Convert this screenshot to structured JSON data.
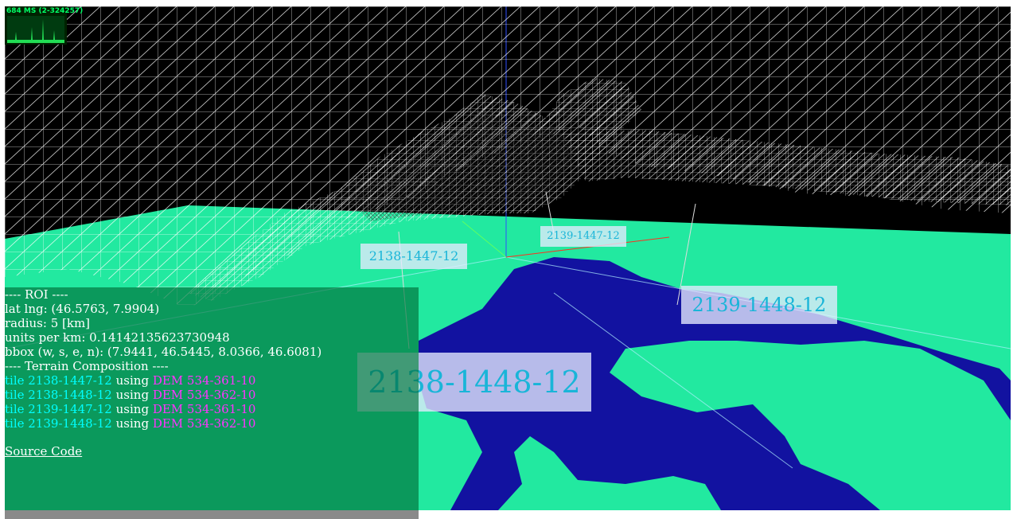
{
  "stats": {
    "text": "684 MS (2-324257)"
  },
  "tile_labels": {
    "t1": "2138-1447-12",
    "t2": "2139-1447-12",
    "t3": "2139-1448-12",
    "t4": "2138-1448-12"
  },
  "info": {
    "roi_header": "---- ROI ----",
    "lat_lng": "lat lng: (46.5763, 7.9904)",
    "radius": "radius: 5 [km]",
    "units_per_km": "units per km: 0.14142135623730948",
    "bbox": "bbox (w, s, e, n): (7.9441, 46.5445, 8.0366, 46.6081)",
    "composition_header": "---- Terrain Composition ----",
    "rows": [
      {
        "prefix": "tile ",
        "tile": "2138-1447-12",
        "mid": " using ",
        "dem": "DEM 534-361-10"
      },
      {
        "prefix": "tile ",
        "tile": "2138-1448-12",
        "mid": " using ",
        "dem": "DEM 534-362-10"
      },
      {
        "prefix": "tile ",
        "tile": "2139-1447-12",
        "mid": " using ",
        "dem": "DEM 534-361-10"
      },
      {
        "prefix": "tile ",
        "tile": "2139-1448-12",
        "mid": " using ",
        "dem": "DEM 534-362-10"
      }
    ],
    "source_link": "Source Code"
  },
  "colors": {
    "tile_name": "#00ffff",
    "dem_name": "#ff33ff",
    "ground_green": "#22e9a0",
    "ground_blue": "#1212a0",
    "label_text": "#19b5d8"
  }
}
